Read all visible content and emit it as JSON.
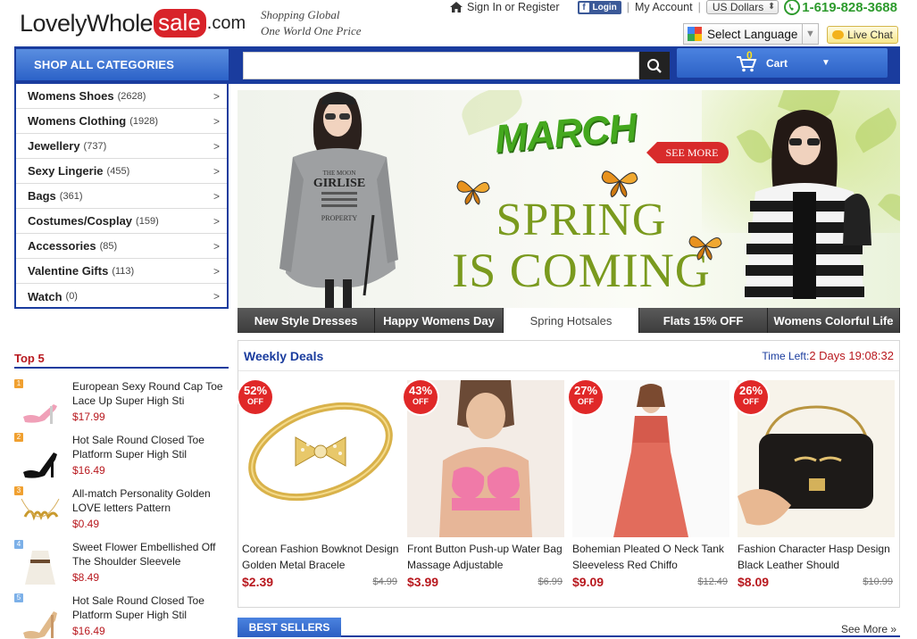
{
  "logo": {
    "part1": "LovelyWhole",
    "part2": "sale",
    "part3": ".com"
  },
  "tagline": {
    "line1": "Shopping Global",
    "line2": "One World One Price"
  },
  "topbar": {
    "sign_in": "Sign In or Register",
    "fb_login": "Login",
    "my_account": "My Account",
    "currency": "US Dollars",
    "phone": "1-619-828-3688"
  },
  "language": {
    "label": "Select Language"
  },
  "live_chat": "Live Chat",
  "nav": {
    "shop_all": "SHOP ALL CATEGORIES",
    "search_placeholder": "",
    "cart_label": "Cart",
    "cart_count": "0"
  },
  "categories": [
    {
      "name": "Womens Shoes",
      "count": "(2628)"
    },
    {
      "name": "Womens Clothing",
      "count": "(1928)"
    },
    {
      "name": "Jewellery",
      "count": "(737)"
    },
    {
      "name": "Sexy Lingerie",
      "count": "(455)"
    },
    {
      "name": "Bags",
      "count": "(361)"
    },
    {
      "name": "Costumes/Cosplay",
      "count": "(159)"
    },
    {
      "name": "Accessories",
      "count": "(85)"
    },
    {
      "name": "Valentine Gifts",
      "count": "(113)"
    },
    {
      "name": "Watch",
      "count": "(0)"
    }
  ],
  "banner": {
    "march": "MARCH",
    "see_more": "SEE MORE",
    "line1": "SPRING",
    "line2": "IS COMING",
    "shirt_text": "GIRLISE"
  },
  "banner_tabs": [
    {
      "label": "New Style Dresses",
      "active": false
    },
    {
      "label": "Happy Womens Day",
      "active": false
    },
    {
      "label": "Spring Hotsales",
      "active": true
    },
    {
      "label": "Flats 15% OFF",
      "active": false
    },
    {
      "label": "Womens Colorful Life",
      "active": false
    }
  ],
  "top5": {
    "title": "Top 5",
    "items": [
      {
        "rank": "1",
        "name": "European Sexy Round Cap Toe Lace Up Super High Sti",
        "price": "$17.99"
      },
      {
        "rank": "2",
        "name": "Hot Sale Round Closed Toe Platform Super High Stil",
        "price": "$16.49"
      },
      {
        "rank": "3",
        "name": "All-match Personality Golden LOVE letters Pattern",
        "price": "$0.49"
      },
      {
        "rank": "4",
        "name": "Sweet Flower Embellished Off The Shoulder Sleevele",
        "price": "$8.49"
      },
      {
        "rank": "5",
        "name": "Hot Sale Round Closed Toe Platform Super High Stil",
        "price": "$16.49"
      }
    ]
  },
  "weekly": {
    "title": "Weekly Deals",
    "time_left_label": "Time Left:",
    "time_left_value": "2 Days 19:08:32",
    "deals": [
      {
        "off": "52%",
        "off_label": "OFF",
        "title": "Corean Fashion Bowknot Design Golden Metal Bracele",
        "price": "$2.39",
        "was": "$4.99"
      },
      {
        "off": "43%",
        "off_label": "OFF",
        "title": "Front Button Push-up Water Bag Massage Adjustable",
        "price": "$3.99",
        "was": "$6.99"
      },
      {
        "off": "27%",
        "off_label": "OFF",
        "title": "Bohemian Pleated O Neck Tank Sleeveless Red Chiffo",
        "price": "$9.09",
        "was": "$12.49"
      },
      {
        "off": "26%",
        "off_label": "OFF",
        "title": "Fashion Character Hasp Design Black Leather Should",
        "price": "$8.09",
        "was": "$10.99"
      }
    ]
  },
  "best_sellers": {
    "title": "BEST SELLERS",
    "see_more": "See More »"
  },
  "colors": {
    "brand_blue": "#1a3c9e",
    "accent_red": "#b8181e",
    "logo_red": "#d8232a",
    "phone_green": "#2e9b2e"
  }
}
